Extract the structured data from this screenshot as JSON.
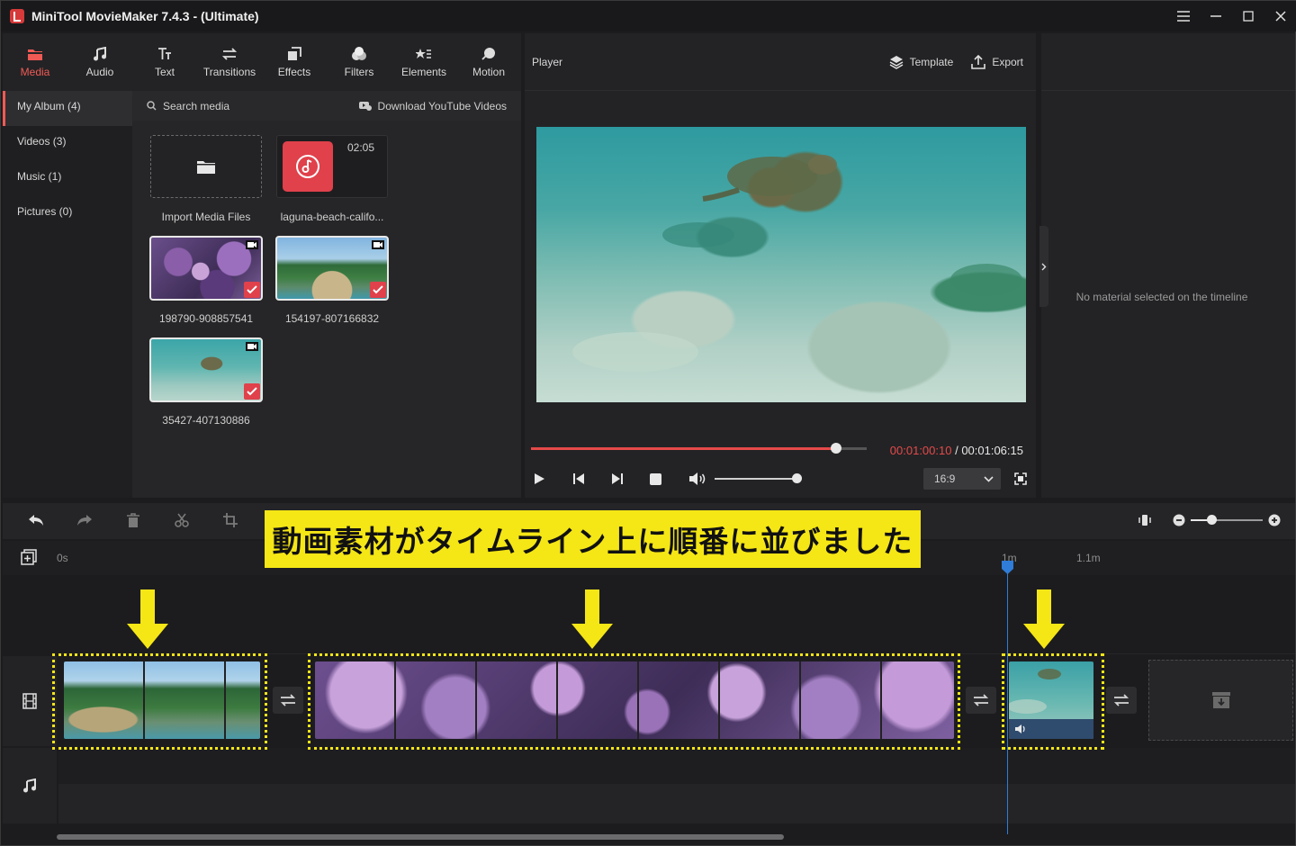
{
  "window": {
    "title": "MiniTool MovieMaker 7.4.3 - (Ultimate)"
  },
  "toolbar": {
    "tabs": [
      {
        "label": "Media",
        "icon": "folder-icon",
        "active": true
      },
      {
        "label": "Audio",
        "icon": "music-note-icon"
      },
      {
        "label": "Text",
        "icon": "text-icon"
      },
      {
        "label": "Transitions",
        "icon": "transition-arrows-icon"
      },
      {
        "label": "Effects",
        "icon": "effects-icon"
      },
      {
        "label": "Filters",
        "icon": "filters-icon"
      },
      {
        "label": "Elements",
        "icon": "elements-icon"
      },
      {
        "label": "Motion",
        "icon": "motion-icon"
      }
    ],
    "accent_color": "#f05a55"
  },
  "sidebar": {
    "items": [
      {
        "label": "My Album (4)",
        "active": true
      },
      {
        "label": "Videos (3)"
      },
      {
        "label": "Music (1)"
      },
      {
        "label": "Pictures (0)"
      }
    ]
  },
  "media": {
    "search_placeholder": "Search media",
    "download_label": "Download YouTube Videos",
    "tiles": [
      {
        "name": "Import Media Files",
        "kind": "import"
      },
      {
        "name": "laguna-beach-califo...",
        "kind": "music",
        "duration": "02:05"
      },
      {
        "name": "198790-908857541",
        "kind": "video",
        "selected": true
      },
      {
        "name": "154197-807166832",
        "kind": "video",
        "selected": true
      },
      {
        "name": "35427-407130886",
        "kind": "video",
        "selected": true
      }
    ]
  },
  "player": {
    "title": "Player",
    "template_label": "Template",
    "export_label": "Export",
    "current_time": "00:01:00:10",
    "separator": " / ",
    "total_time": "00:01:06:15",
    "progress": 0.91,
    "volume": 1.0,
    "aspect_ratio": "16:9"
  },
  "properties": {
    "empty_message": "No material selected on the timeline"
  },
  "timeline": {
    "ruler": {
      "start": "0s",
      "mark_1": "1m",
      "mark_2": "1.1m"
    },
    "zoom_level": 0.3,
    "playhead_color": "#2f7dd8"
  },
  "annotation": {
    "banner_text": "動画素材がタイムライン上に順番に並びました",
    "highlight_color": "#f5e616"
  }
}
